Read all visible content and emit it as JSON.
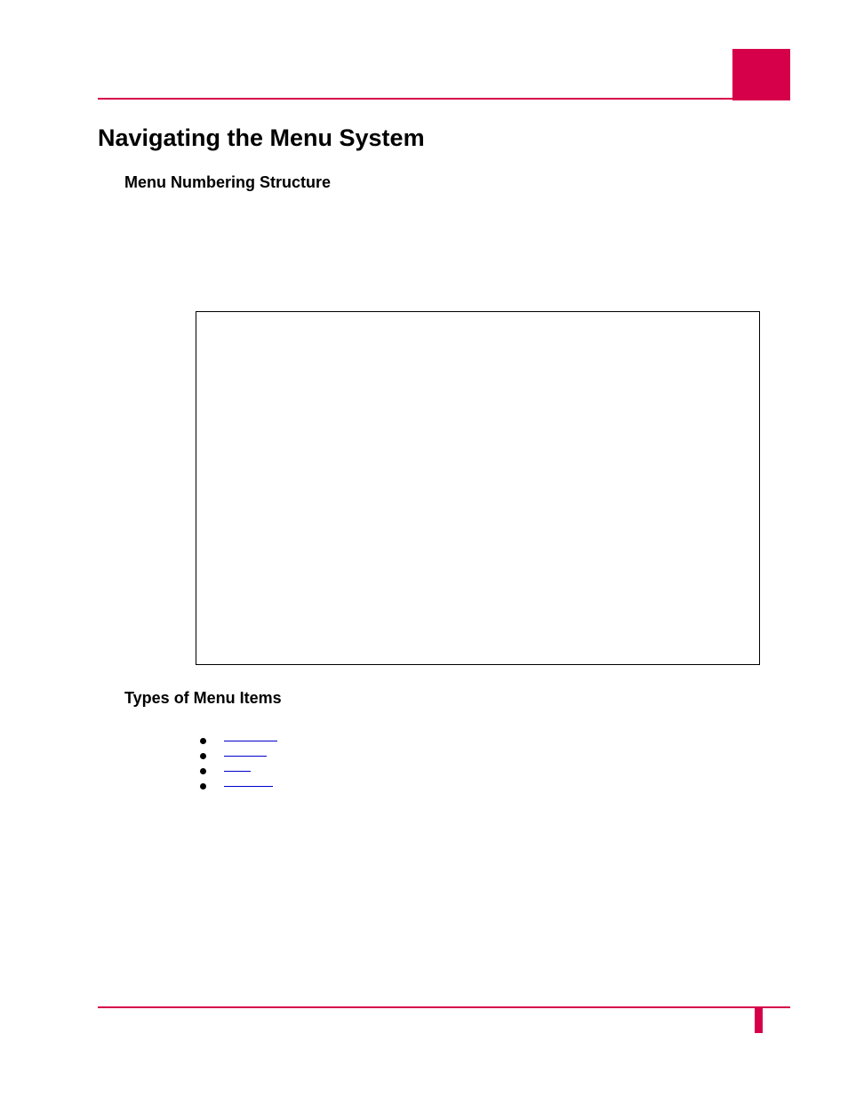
{
  "headings": {
    "main": "Navigating the Menu System",
    "sub1": "Menu Numbering Structure",
    "sub2": "Types of Menu Items"
  }
}
